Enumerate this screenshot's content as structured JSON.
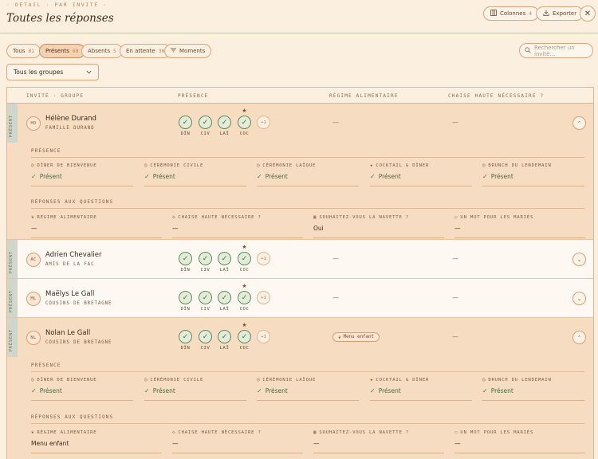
{
  "header": {
    "eyebrow": "· DÉTAIL · PAR INVITÉ ·",
    "title": "Toutes les réponses",
    "columns_label": "Colonnes",
    "columns_count": "4",
    "export_label": "Exporter",
    "close_glyph": "✕"
  },
  "filters": {
    "tabs": [
      {
        "label": "Tous",
        "count": "81"
      },
      {
        "label": "Présents",
        "count": "68"
      },
      {
        "label": "Absents",
        "count": "5"
      },
      {
        "label": "En attente",
        "count": "36"
      },
      {
        "label": "Moments",
        "count": ""
      }
    ],
    "search_placeholder": "Rechercher un invité…",
    "group_select": "Tous les groupes"
  },
  "table": {
    "columns": [
      "INVITÉ · GROUPE",
      "PRÉSENCE",
      "RÉGIME ALIMENTAIRE",
      "CHAISE HAUTE NÉCESSAIRE ?"
    ],
    "moment_labels": [
      "DÎN",
      "CIV",
      "LAÏ",
      "COC"
    ],
    "plus": "+1",
    "side_tag": "PRÉSENT",
    "rows": [
      {
        "initials": "HD",
        "name": "Hélène Durand",
        "group": "FAMILLE DURAND",
        "diet": "—",
        "chair": "—",
        "toggle": "⌃"
      },
      {
        "initials": "AC",
        "name": "Adrien Chevalier",
        "group": "AMIS DE LA FAC",
        "diet": "—",
        "chair": "—",
        "toggle": "⌄"
      },
      {
        "initials": "ML",
        "name": "Maëlys Le Gall",
        "group": "COUSINS DE BRETAGNE",
        "diet": "—",
        "chair": "—",
        "toggle": "⌄"
      },
      {
        "initials": "NL",
        "name": "Nolan Le Gall",
        "group": "COUSINS DE BRETAGNE",
        "diet_badge": "Menu enfant",
        "chair": "—",
        "toggle": "⌃"
      }
    ]
  },
  "detail": {
    "presence_title": "PRÉSENCE",
    "questions_title": "RÉPONSES AUX QUESTIONS",
    "moments": [
      "DÎNER DE BIENVENUE",
      "CÉRÉMONIE CIVILE",
      "CÉRÉMONIE LAÏQUE",
      "COCKTAIL & DÎNER",
      "BRUNCH DU LENDEMAIN"
    ],
    "present": "Présent",
    "questions": [
      "RÉGIME ALIMENTAIRE",
      "CHAISE HAUTE NÉCESSAIRE ?",
      "SOUHAITEZ-VOUS LA NAVETTE ?",
      "UN MOT POUR LES MARIÉS"
    ],
    "answers_1": [
      "—",
      "—",
      "Oui",
      "—"
    ],
    "answers_4": [
      "Menu enfant",
      "—",
      "—",
      "—"
    ]
  }
}
